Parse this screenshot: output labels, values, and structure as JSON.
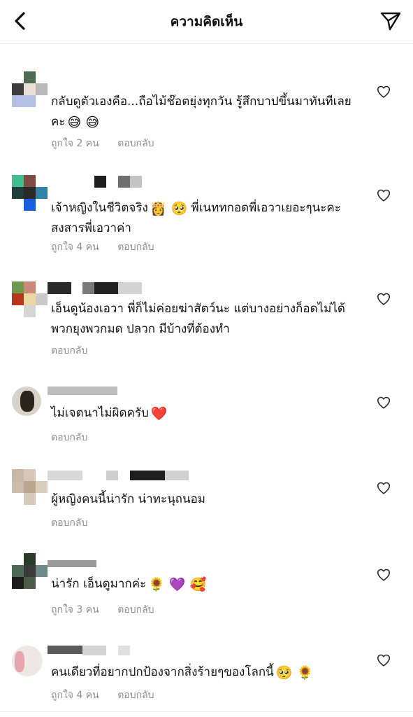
{
  "header": {
    "title": "ความคิดเห็น",
    "back_icon": "chevron-left-icon",
    "send_icon": "paper-plane-icon"
  },
  "colors": {
    "text": "#111111",
    "secondary": "#8e8e8e",
    "heart_red": "#e8222b",
    "heart_purple": "#9b3fd6"
  },
  "comments": [
    {
      "text": "กลับดูตัวเองคือ...ถือไม้ช๊อตยุ่งทุกวัน รู้สึกบาปขึ้นมาทันทีเลยคะ",
      "emojis": "😅 😅",
      "likes": "ถูกใจ 2 คน",
      "reply": "ตอบกลับ"
    },
    {
      "text": "เจ้าหญิงในชีวิตจริง",
      "emoji_mid": "👸 🥺",
      "text2": " พี่เนททกอดพี่เอวาเยอะๆนะคะ สงสารพี่เอวาค่า",
      "likes": "ถูกใจ 4 คน",
      "reply": "ตอบกลับ"
    },
    {
      "text": "เอ็นดูน้องเอวา พี่ก็ไม่ค่อยฆ่าสัตว์นะ แต่บางอย่างก็อดไม่ได้ พวกยุงพวกมด ปลวก มีบ้างที่ต้องทำ",
      "reply": "ตอบกลับ"
    },
    {
      "text": "ไม่เจตนาไม่ผิดครับ",
      "emojis": "❤️",
      "reply": "ตอบกลับ"
    },
    {
      "text": "ผู้หญิงคนนี้น่ารัก น่าทะนุถนอม",
      "reply": "ตอบกลับ"
    },
    {
      "text": "น่ารัก เอ็นดูมากค่ะ",
      "emojis": "🌻 💜 🥰",
      "likes": "ถูกใจ 3 คน",
      "reply": "ตอบกลับ"
    },
    {
      "text": "คนเดียวที่อยากปกป้องจากสิ่งร้ายๆของโลกนี้",
      "emojis": "🥺 🌻",
      "likes": "ถูกใจ 4 คน",
      "reply": "ตอบกลับ"
    }
  ]
}
